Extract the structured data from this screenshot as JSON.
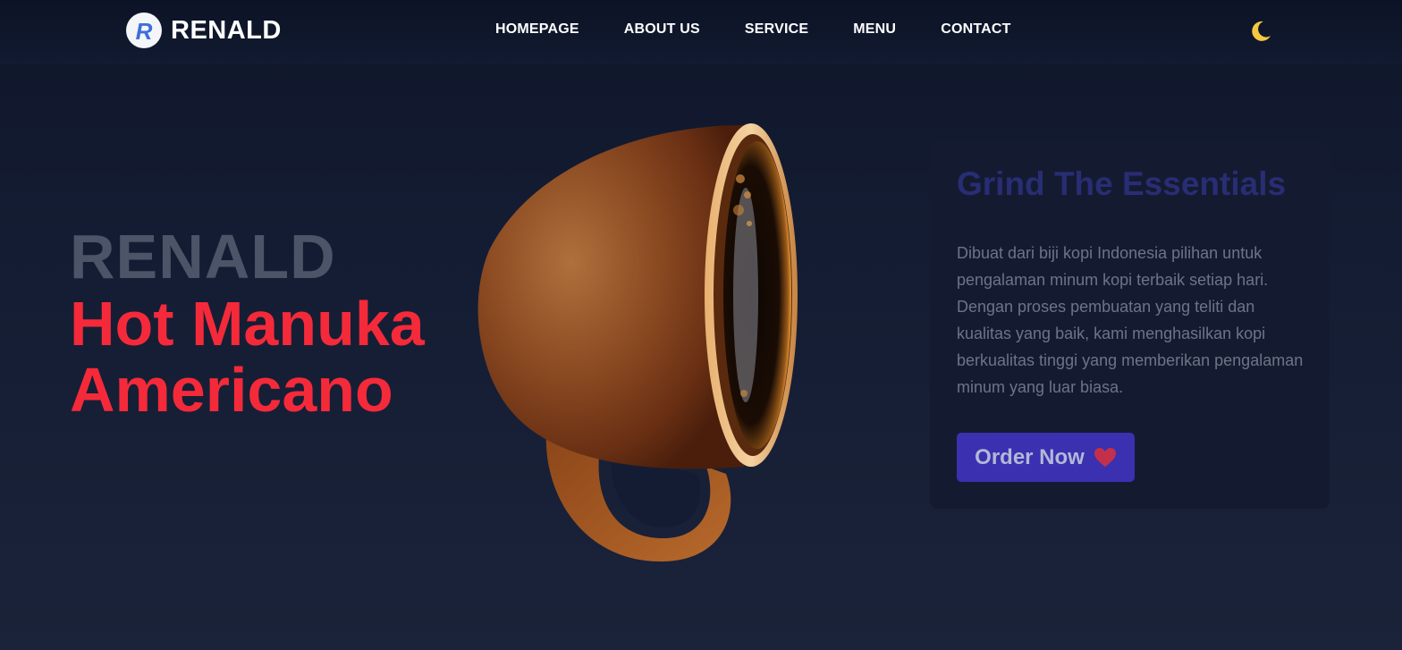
{
  "header": {
    "brand": "RENALD",
    "logo_letter": "R",
    "nav": [
      {
        "label": "HOMEPAGE"
      },
      {
        "label": "ABOUT US"
      },
      {
        "label": "SERVICE"
      },
      {
        "label": "MENU"
      },
      {
        "label": "CONTACT"
      }
    ],
    "theme_icon": "moon-icon"
  },
  "hero": {
    "brand": "RENALD",
    "product_line1": "Hot Manuka",
    "product_line2": "Americano",
    "image_icon": "coffee-cup-image"
  },
  "card": {
    "title": "Grind The Essentials",
    "description": "Dibuat dari biji kopi Indonesia pilihan untuk pengalaman minum kopi terbaik setiap hari. Dengan proses pembuatan yang teliti dan kualitas yang baik, kami menghasilkan kopi berkualitas tinggi yang memberikan pengalaman minum yang luar biasa.",
    "button_label": "Order Now",
    "button_icon": "heart-icon"
  },
  "colors": {
    "background": "#141c33",
    "accent_red": "#f42a3a",
    "button": "#3b30b0",
    "moon": "#f5c842",
    "heart": "#c4304a"
  }
}
